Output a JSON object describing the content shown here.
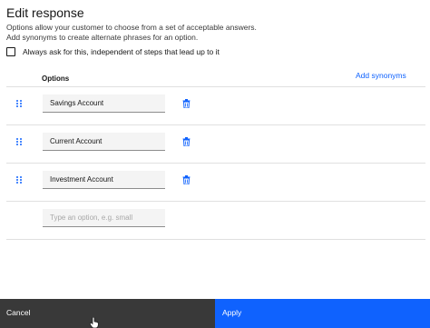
{
  "dialog": {
    "title": "Edit response",
    "description_line1": "Options allow your customer to choose from a set of acceptable answers.",
    "description_line2": "Add synonyms to create alternate phrases for an option."
  },
  "always_ask": {
    "label": "Always ask for this, independent of steps that lead up to it",
    "checked": false
  },
  "options_table": {
    "header": "Options",
    "add_synonyms_label": "Add synonyms",
    "options": [
      {
        "value": "Savings Account"
      },
      {
        "value": "Current Account"
      },
      {
        "value": "Investment Account"
      }
    ],
    "new_option_placeholder": "Type an option, e.g. small"
  },
  "footer": {
    "cancel_label": "Cancel",
    "apply_label": "Apply"
  },
  "colors": {
    "accent": "#0f62fe",
    "cancel_bg": "#393939",
    "input_bg": "#f4f4f4",
    "divider": "#e0e0e0"
  },
  "icons": {
    "drag": "drag-handle-icon",
    "delete": "trash-icon",
    "checkbox": "checkbox-icon"
  }
}
